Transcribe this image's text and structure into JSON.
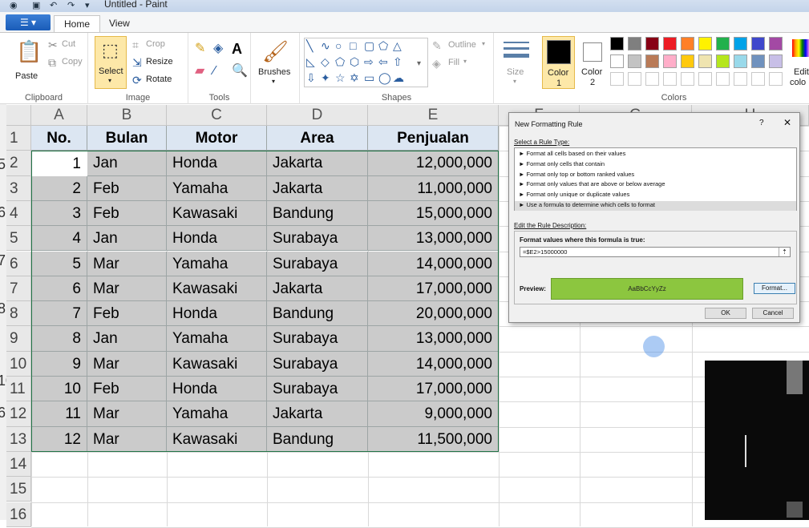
{
  "window": {
    "title": "Untitled - Paint"
  },
  "tabs": {
    "home": "Home",
    "view": "View"
  },
  "clipboard": {
    "paste": "Paste",
    "cut": "Cut",
    "copy": "Copy",
    "label": "Clipboard"
  },
  "image": {
    "select": "Select",
    "crop": "Crop",
    "resize": "Resize",
    "rotate": "Rotate",
    "label": "Image"
  },
  "tools": {
    "label": "Tools"
  },
  "brushes": {
    "label": "Brushes"
  },
  "shapes": {
    "outline": "Outline",
    "fill": "Fill",
    "label": "Shapes"
  },
  "size": {
    "label": "Size"
  },
  "colors": {
    "color1": "Color",
    "color1_num": "1",
    "color2": "Color",
    "color2_num": "2",
    "edit": "Edit",
    "edit2": "colo",
    "label": "Colors",
    "palette_row1": [
      "#000000",
      "#7f7f7f",
      "#880015",
      "#ed1c24",
      "#ff7f27",
      "#fff200",
      "#22b14c",
      "#00a2e8",
      "#3f48cc",
      "#a349a4"
    ],
    "palette_row2": [
      "#ffffff",
      "#c3c3c3",
      "#b97a57",
      "#ffaec9",
      "#ffc90e",
      "#efe4b0",
      "#b5e61d",
      "#99d9ea",
      "#7092be",
      "#c8bfe7"
    ]
  },
  "sheet": {
    "columns": [
      "A",
      "B",
      "C",
      "D",
      "E",
      "F",
      "G",
      "H"
    ],
    "rows": [
      "1",
      "2",
      "3",
      "4",
      "5",
      "6",
      "7",
      "8",
      "9",
      "10",
      "11",
      "12",
      "13",
      "14",
      "15",
      "16"
    ],
    "headers": [
      "No.",
      "Bulan",
      "Motor",
      "Area",
      "Penjualan"
    ],
    "data": [
      [
        "1",
        "Jan",
        "Honda",
        "Jakarta",
        "12,000,000"
      ],
      [
        "2",
        "Feb",
        "Yamaha",
        "Jakarta",
        "11,000,000"
      ],
      [
        "3",
        "Feb",
        "Kawasaki",
        "Bandung",
        "15,000,000"
      ],
      [
        "4",
        "Jan",
        "Honda",
        "Surabaya",
        "13,000,000"
      ],
      [
        "5",
        "Mar",
        "Yamaha",
        "Surabaya",
        "14,000,000"
      ],
      [
        "6",
        "Mar",
        "Kawasaki",
        "Jakarta",
        "17,000,000"
      ],
      [
        "7",
        "Feb",
        "Honda",
        "Bandung",
        "20,000,000"
      ],
      [
        "8",
        "Jan",
        "Yamaha",
        "Surabaya",
        "13,000,000"
      ],
      [
        "9",
        "Mar",
        "Kawasaki",
        "Surabaya",
        "14,000,000"
      ],
      [
        "10",
        "Feb",
        "Honda",
        "Surabaya",
        "17,000,000"
      ],
      [
        "11",
        "Mar",
        "Yamaha",
        "Jakarta",
        "9,000,000"
      ],
      [
        "12",
        "Mar",
        "Kawasaki",
        "Bandung",
        "11,500,000"
      ]
    ]
  },
  "dialog": {
    "title": "New Formatting Rule",
    "help": "?",
    "close": "✕",
    "select_type_label": "Select a Rule Type:",
    "rules": [
      "► Format all cells based on their values",
      "► Format only cells that contain",
      "► Format only top or bottom ranked values",
      "► Format only values that are above or below average",
      "► Format only unique or duplicate values",
      "► Use a formula to determine which cells to format"
    ],
    "edit_label": "Edit the Rule Description:",
    "formula_label": "Format values where this formula is true:",
    "formula": "=$E2>15000000",
    "preview_label": "Preview:",
    "preview_text": "AaBbCcYyZz",
    "format_btn": "Format...",
    "ok": "OK",
    "cancel": "Cancel"
  }
}
